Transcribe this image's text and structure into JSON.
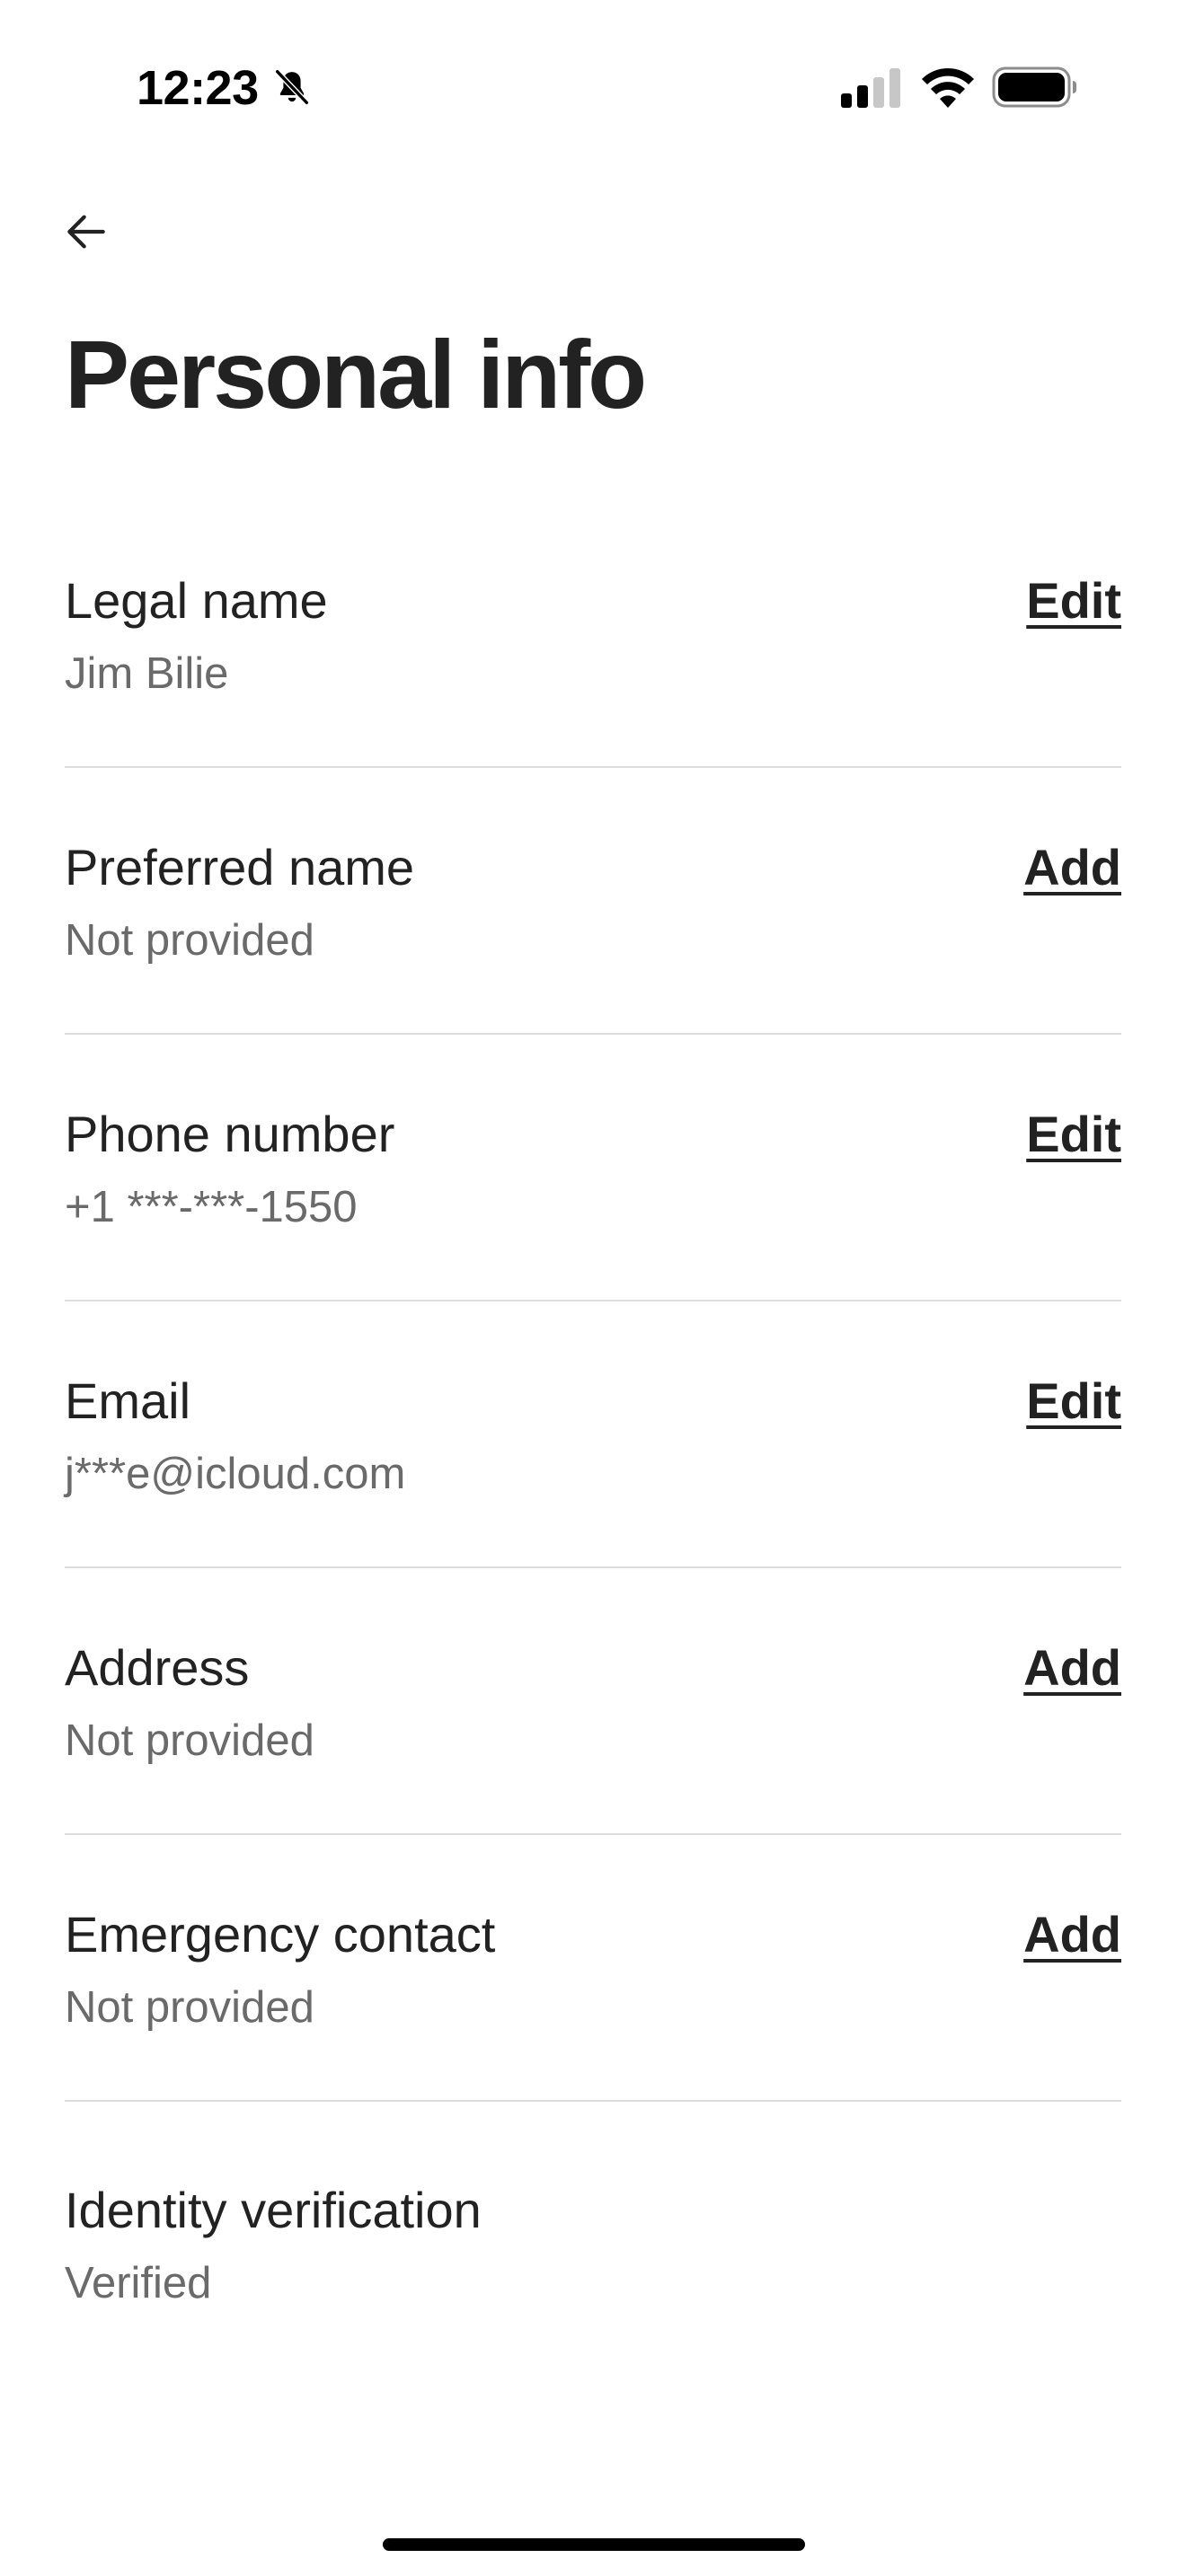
{
  "status_bar": {
    "time": "12:23",
    "icons": [
      "bell-slash-icon",
      "cellular-signal-icon",
      "wifi-icon",
      "battery-icon"
    ]
  },
  "nav": {
    "back_icon": "arrow-left-icon"
  },
  "page": {
    "title": "Personal info"
  },
  "rows": [
    {
      "label": "Legal name",
      "value": "Jim Bilie",
      "action": "Edit"
    },
    {
      "label": "Preferred name",
      "value": "Not provided",
      "action": "Add"
    },
    {
      "label": "Phone number",
      "value": "+1 ***-***-1550",
      "action": "Edit"
    },
    {
      "label": "Email",
      "value": "j***e@icloud.com",
      "action": "Edit"
    },
    {
      "label": "Address",
      "value": "Not provided",
      "action": "Add"
    },
    {
      "label": "Emergency contact",
      "value": "Not provided",
      "action": "Add"
    },
    {
      "label": "Identity verification",
      "value": "Verified"
    }
  ],
  "colors": {
    "text_primary": "#222222",
    "text_secondary": "#6a6a6a",
    "divider": "#dddddd",
    "background": "#ffffff"
  }
}
